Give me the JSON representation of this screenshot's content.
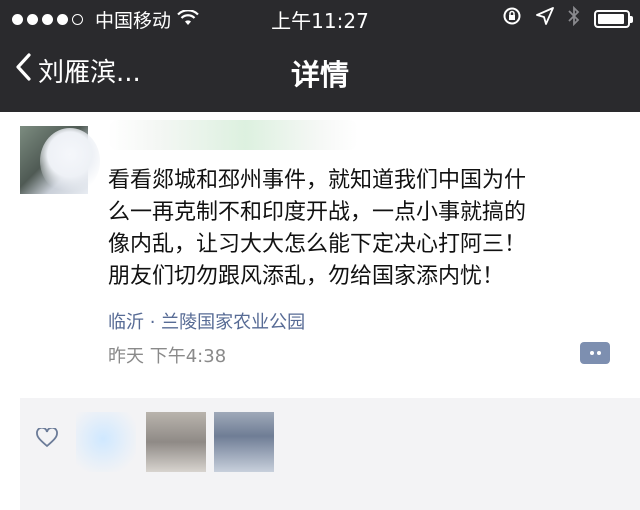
{
  "status_bar": {
    "carrier": "中国移动",
    "time": "上午11:27"
  },
  "nav": {
    "back_label": "刘雁滨...",
    "title": "详情"
  },
  "post": {
    "text_lines": [
      "看看郯城和邳州事件，就知道我们中国为什",
      "么一再克制不和印度开战，一点小事就搞的",
      "像内乱，让习大大怎么能下定决心打阿三！",
      "朋友们切勿跟风添乱，勿给国家添内忧！"
    ],
    "location": "临沂 · 兰陵国家农业公园",
    "timestamp": "昨天 下午4:38"
  },
  "colors": {
    "topbar": "#2a2a2d",
    "link": "#576b95",
    "likes_bg": "#f3f3f5"
  }
}
